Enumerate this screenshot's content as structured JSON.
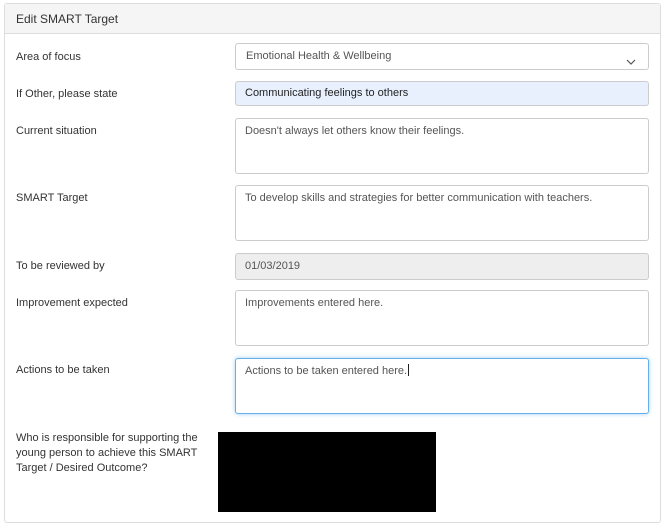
{
  "panel": {
    "title": "Edit SMART Target"
  },
  "fields": {
    "area_of_focus": {
      "label": "Area of focus",
      "value": "Emotional Health & Wellbeing"
    },
    "if_other": {
      "label": "If Other, please state",
      "value": "Communicating feelings to others"
    },
    "current_situation": {
      "label": "Current situation",
      "value": "Doesn't always let others know their feelings."
    },
    "smart_target": {
      "label": "SMART Target",
      "value": "To develop skills and strategies for better communication with teachers."
    },
    "review_date": {
      "label": "To be reviewed by",
      "value": "01/03/2019"
    },
    "improvement": {
      "label": "Improvement expected",
      "value": "Improvements entered here."
    },
    "actions": {
      "label": "Actions to be taken",
      "value": "Actions to be taken entered here."
    },
    "responsible": {
      "label": "Who is responsible for supporting the young person to achieve this SMART Target / Desired Outcome?"
    }
  },
  "icons": {
    "select_arrow": "chevron-down-icon"
  },
  "colors": {
    "highlight_bg": "#e8f0fe",
    "disabled_bg": "#eeeeee",
    "focus_border": "#66afe9",
    "redaction": "#000000"
  }
}
